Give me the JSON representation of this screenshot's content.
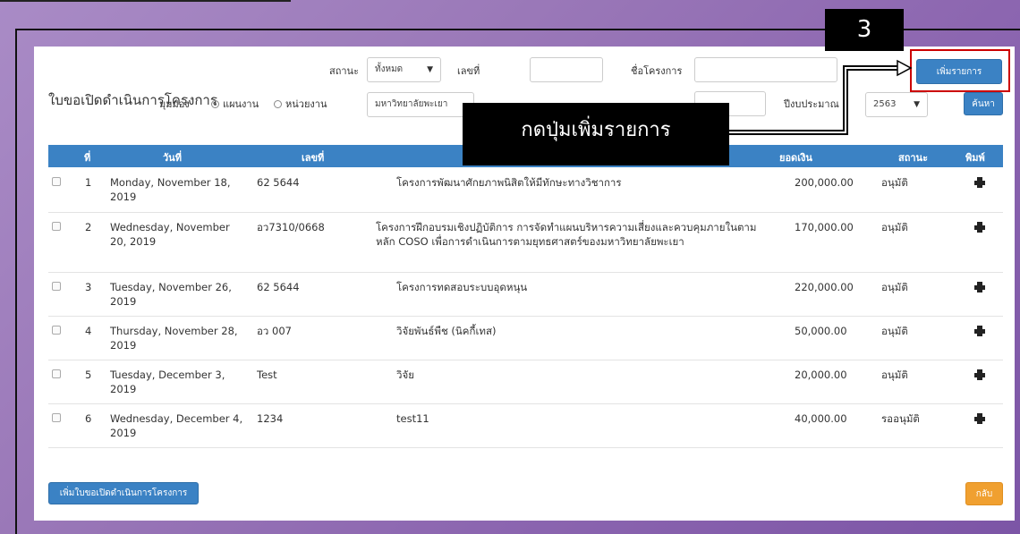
{
  "form": {
    "title": "ใบขอเปิดดำเนินการโครงการ",
    "status_label": "สถานะ",
    "status_value": "ทั้งหมด",
    "number_label": "เลขที่",
    "number_value": "",
    "project_name_label": "ชื่อโครงการ",
    "project_name_value": "",
    "view_label": "มุมมอง",
    "view_option_plan": "แผนงาน",
    "view_option_unit": "หน่วยงาน",
    "unit_value": "มหาวิทยาลัยพะเยา",
    "fiscal_year_label": "ปีงบประมาณ",
    "fiscal_year_value": "2563",
    "add_item_button": "เพิ่มรายการ",
    "search_button": "ค้นหา"
  },
  "annotation": {
    "step_number": "3",
    "callout_text": "กดปุ่มเพิ่มรายการ",
    "highlight_color": "#cc0000"
  },
  "table": {
    "columns": [
      "ที่",
      "วันที่",
      "เลขที่",
      "ยอดเงิน",
      "สถานะ",
      "พิมพ์"
    ],
    "rows": [
      {
        "no": "1",
        "date": "Monday, November 18, 2019",
        "number": "62 5644",
        "project": "โครงการพัฒนาศักยภาพนิสิตให้มีทักษะทางวิชาการ",
        "amount": "200,000.00",
        "status": "อนุมัติ"
      },
      {
        "no": "2",
        "date": "Wednesday, November 20, 2019",
        "number": "อว7310/0668",
        "project": "โครงการฝึกอบรมเชิงปฏิบัติการ การจัดทำแผนบริหารความเสี่ยงและควบคุมภายในตามหลัก COSO เพื่อการดำเนินการตามยุทธศาสตร์ของมหาวิทยาลัยพะเยา",
        "amount": "170,000.00",
        "status": "อนุมัติ"
      },
      {
        "no": "3",
        "date": "Tuesday, November 26, 2019",
        "number": "62 5644",
        "project": "โครงการทดสอบระบบอุดหนุน",
        "amount": "220,000.00",
        "status": "อนุมัติ"
      },
      {
        "no": "4",
        "date": "Thursday, November 28, 2019",
        "number": "อว 007",
        "project": "วิจัยพันธ์พืช (นิคกี้เทส)",
        "amount": "50,000.00",
        "status": "อนุมัติ"
      },
      {
        "no": "5",
        "date": "Tuesday, December 3, 2019",
        "number": "Test",
        "project": "วิจัย",
        "amount": "20,000.00",
        "status": "อนุมัติ"
      },
      {
        "no": "6",
        "date": "Wednesday, December 4, 2019",
        "number": "1234",
        "project": "test11",
        "amount": "40,000.00",
        "status": "รออนุมัติ"
      }
    ]
  },
  "footer": {
    "add_request_button": "เพิ่มใบขอเปิดดำเนินการโครงการ",
    "back_button": "กลับ"
  },
  "colors": {
    "primary": "#3b82c4",
    "back": "#f0a030"
  }
}
